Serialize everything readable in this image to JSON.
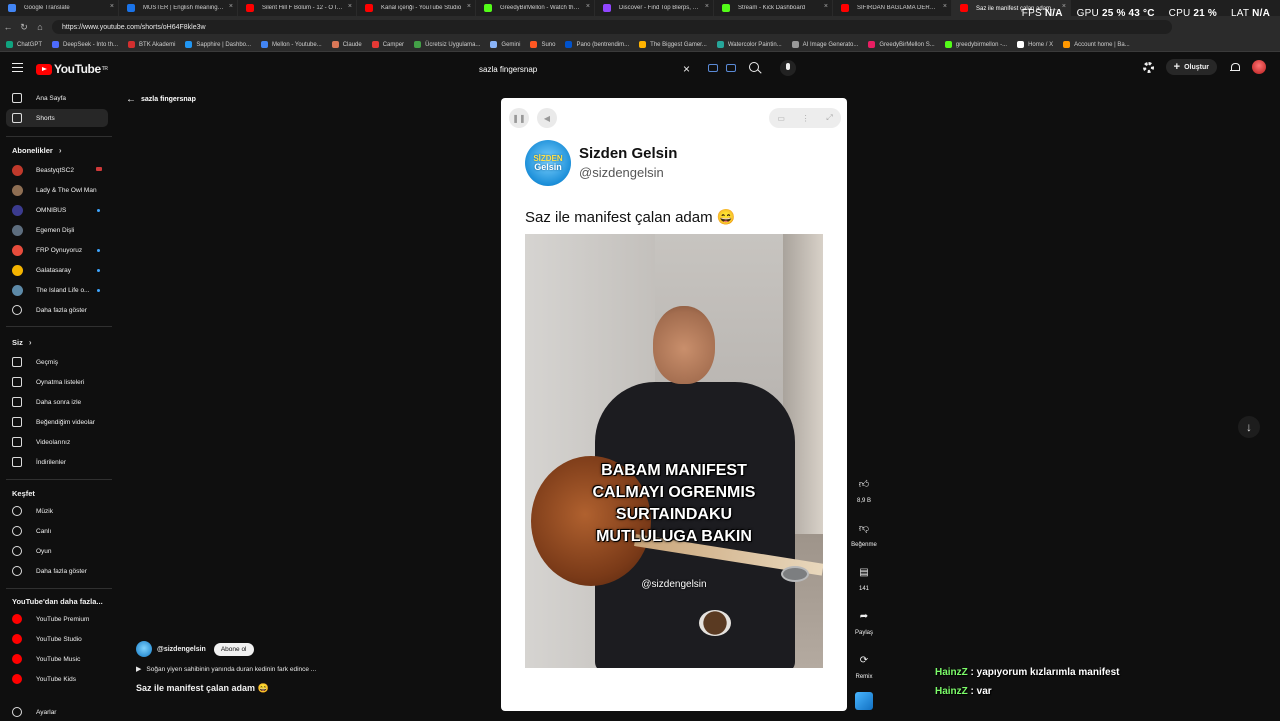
{
  "browser": {
    "tabs": [
      {
        "label": "Google Translate",
        "color": "#4285f4"
      },
      {
        "label": "MUSTER | English meaning - Camb",
        "color": "#1a73e8"
      },
      {
        "label": "Silent Hill F Bölüm - 12 - O İkili cal",
        "color": "#ff0000"
      },
      {
        "label": "Kanal içeriği - YouTube Studio",
        "color": "#ff0000"
      },
      {
        "label": "GreedyBirMellon - Watch the VOD",
        "color": "#53fc18"
      },
      {
        "label": "Discover - Find Top Blerps, Stream",
        "color": "#9146ff"
      },
      {
        "label": "Stream - Kick Dashboard",
        "color": "#53fc18"
      },
      {
        "label": "SIFIRDAN BAĞLAMA DERSİ 2 ( PA",
        "color": "#ff0000"
      },
      {
        "label": "Saz ile manifest çalan adam 😄",
        "color": "#ff0000",
        "active": true
      }
    ],
    "url": "https://www.youtube.com/shorts/oH64F8kle3w",
    "bookmarks": [
      {
        "label": "ChatGPT",
        "color": "#10a37f"
      },
      {
        "label": "DeepSeek - Into th...",
        "color": "#4d6bfe"
      },
      {
        "label": "BTK Akademi",
        "color": "#d32f2f"
      },
      {
        "label": "Sapphire | Dashbo...",
        "color": "#2196f3"
      },
      {
        "label": "Mellon - Youtube...",
        "color": "#4285f4"
      },
      {
        "label": "Claude",
        "color": "#d97757"
      },
      {
        "label": "Camper",
        "color": "#e53935"
      },
      {
        "label": "Ücretsiz Uygulama...",
        "color": "#43a047"
      },
      {
        "label": "Gemini",
        "color": "#8ab4f8"
      },
      {
        "label": "Suno",
        "color": "#ff5722"
      },
      {
        "label": "Pano (bentrendim...",
        "color": "#0052cc"
      },
      {
        "label": "The Biggest Gamer...",
        "color": "#ffb300"
      },
      {
        "label": "Watercolor Paintin...",
        "color": "#26a69a"
      },
      {
        "label": "AI Image Generato...",
        "color": "#999999"
      },
      {
        "label": "GreedyBirMellon S...",
        "color": "#e91e63"
      },
      {
        "label": "greedybirmellon -...",
        "color": "#53fc18"
      },
      {
        "label": "Home / X",
        "color": "#ffffff"
      },
      {
        "label": "Account home | Ba...",
        "color": "#ff9800"
      }
    ]
  },
  "hud": {
    "fps_label": "FPS",
    "fps_value": "N/A",
    "gpu_label": "GPU",
    "gpu_value": "25 % 43 °C",
    "cpu_label": "CPU",
    "cpu_value": "21 %",
    "lat_label": "LAT",
    "lat_value": "N/A"
  },
  "youtube": {
    "logo_text": "YouTube",
    "logo_sup": "TR",
    "search_query": "sazla fingersnap",
    "create_label": "Oluştur"
  },
  "sidebar": {
    "main": [
      {
        "label": "Ana Sayfa",
        "icon": "home-icon"
      },
      {
        "label": "Shorts",
        "icon": "shorts-icon",
        "active": true
      }
    ],
    "subs_title": "Abonelikler",
    "subscriptions": [
      {
        "label": "BeastyqtSC2",
        "color": "#c0392b",
        "badge": "live"
      },
      {
        "label": "Lady & The Owl Man",
        "color": "#8e6e53"
      },
      {
        "label": "OMNIBUS",
        "color": "#3b3b8f",
        "badge": "dot"
      },
      {
        "label": "Egemen Dişli",
        "color": "#5d6d7e"
      },
      {
        "label": "FRP Oynuyoruz",
        "color": "#e74c3c",
        "badge": "dot"
      },
      {
        "label": "Galatasaray",
        "color": "#f4b400",
        "badge": "dot"
      },
      {
        "label": "The Island Life o...",
        "color": "#5d8aa8",
        "badge": "dot"
      }
    ],
    "show_more": "Daha fazla göster",
    "you_title": "Siz",
    "you_items": [
      {
        "label": "Geçmiş",
        "icon": "history-icon"
      },
      {
        "label": "Oynatma listeleri",
        "icon": "playlists-icon"
      },
      {
        "label": "Daha sonra izle",
        "icon": "watch-later-icon"
      },
      {
        "label": "Beğendiğim videolar",
        "icon": "liked-icon"
      },
      {
        "label": "Videolarınız",
        "icon": "your-videos-icon"
      },
      {
        "label": "İndirilenler",
        "icon": "downloads-icon"
      }
    ],
    "explore_title": "Keşfet",
    "explore_items": [
      {
        "label": "Müzik",
        "icon": "music-icon"
      },
      {
        "label": "Canlı",
        "icon": "live-icon"
      },
      {
        "label": "Oyun",
        "icon": "gaming-icon"
      }
    ],
    "explore_more": "Daha fazla göster",
    "more_title": "YouTube'dan daha fazla...",
    "more_items": [
      {
        "label": "YouTube Premium"
      },
      {
        "label": "YouTube Studio"
      },
      {
        "label": "YouTube Music"
      },
      {
        "label": "YouTube Kids"
      }
    ],
    "settings": "Ayarlar"
  },
  "back": {
    "label": "sazla fingersnap"
  },
  "short": {
    "channel_name": "Sizden Gelsin",
    "channel_handle": "@sizdengelsin",
    "logo_line1": "SİZDEN",
    "logo_line2": "Gelsin",
    "post_text": "Saz ile manifest çalan adam 😄",
    "caption": "BABAM MANIFEST\nCALMAYI OGRENMIS\nSURTAINDAKU\nMUTLULUGA BAKIN",
    "watermark": "@sizdengelsin"
  },
  "actions": {
    "like_count": "8,9 B",
    "dislike_label": "Beğenme",
    "comments_count": "141",
    "share_label": "Paylaş",
    "remix_label": "Remix"
  },
  "meta": {
    "channel": "@sizdengelsin",
    "subscribe": "Abone ol",
    "playlist": "Soğan yiyen sahibinin yanında duran kedinin fark edince ...",
    "title": "Saz ile manifest çalan adam 😄"
  },
  "chat": [
    {
      "user": "HainzZ",
      "message": "yapıyorum kızlarımla manifest"
    },
    {
      "user": "HainzZ",
      "message": "var"
    }
  ]
}
